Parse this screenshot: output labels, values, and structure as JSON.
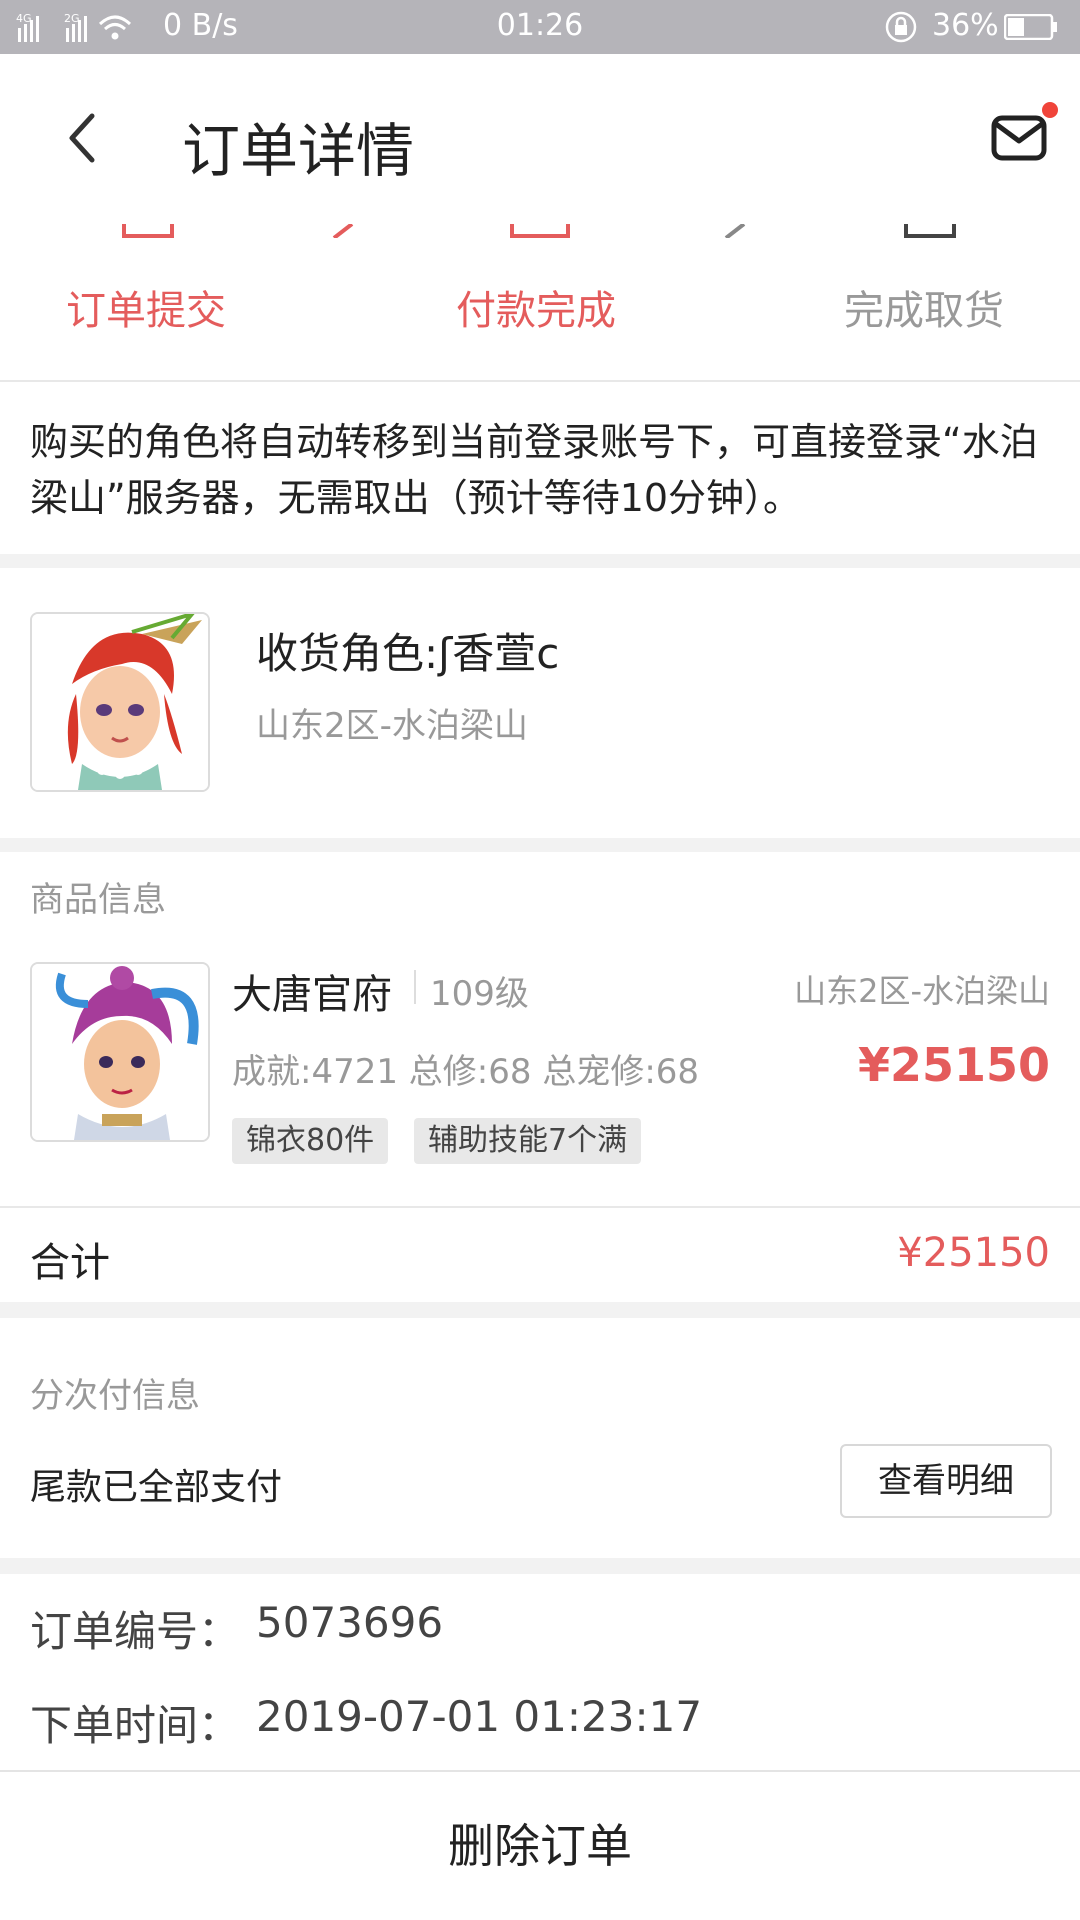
{
  "status_bar": {
    "network": "0 B/s",
    "time": "01:26",
    "battery": "36%"
  },
  "header": {
    "title": "订单详情"
  },
  "progress": {
    "steps": [
      {
        "label": "订单提交",
        "state": "done"
      },
      {
        "label": "付款完成",
        "state": "done"
      },
      {
        "label": "完成取货",
        "state": "pending"
      }
    ]
  },
  "notice": {
    "text": "购买的角色将自动转移到当前登录账号下，可直接登录“水泊梁山”服务器，无需取出（预计等待10分钟）。"
  },
  "receiver": {
    "name": "收货角色:ʃ香萱c",
    "server": "山东2区-水泊梁山"
  },
  "goods": {
    "section_label": "商品信息",
    "name": "大唐官府",
    "level": "109级",
    "server": "山东2区-水泊梁山",
    "stats": "成就:4721 总修:68 总宠修:68",
    "price": "¥25150",
    "tags": [
      "锦衣80件",
      "辅助技能7个满"
    ]
  },
  "total": {
    "label": "合计",
    "price": "¥25150"
  },
  "installment": {
    "section_label": "分次付信息",
    "status": "尾款已全部支付",
    "button": "查看明细"
  },
  "order": {
    "number_label": "订单编号：",
    "number": "5073696",
    "time_label": "下单时间：",
    "time": "2019-07-01 01:23:17"
  },
  "actions": {
    "delete": "删除订单"
  },
  "colors": {
    "accent": "#e45c5c",
    "status_bar": "#b5b4b9",
    "muted": "#999999"
  },
  "icons": {
    "back": "chevron-left-icon",
    "mail": "mail-icon"
  }
}
